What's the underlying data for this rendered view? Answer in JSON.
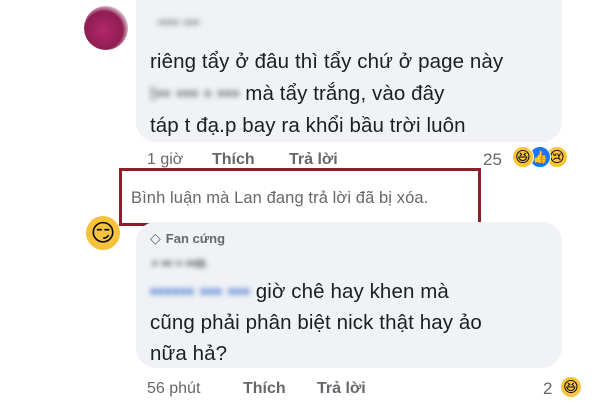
{
  "comment1": {
    "author": "▪▪▪▪ ▪▪▪",
    "line1": "riêng tẩy ở đâu thì tẩy chứ ở page này",
    "line2_blurred": "t▪▪ ▪▪▪ ▪ ▪▪▪",
    "line2": "mà tẩy trắng, vào đây",
    "line3": "táp t đạ.p bay ra khổi bầu trời luôn",
    "time": "1 giờ",
    "like": "Thích",
    "reply": "Trả lời",
    "reaction_count": "25"
  },
  "notice": {
    "text": "Bình luận mà Lan đang trả lời đã bị xóa."
  },
  "comment2": {
    "badge": "Fan cứng",
    "author": "▪ ▪▪ ▪ ▪▪n",
    "line1_blurred": "▪▪▪▪▪▪ ▪▪▪ ▪▪▪",
    "line1": "giờ chê hay khen mà",
    "line2": "cũng phải phân biệt nick thật hay ảo",
    "line3": "nữa hả?",
    "time": "56 phút",
    "like": "Thích",
    "reply": "Trả lời",
    "reaction_count": "2"
  },
  "icons": {
    "haha": "😆",
    "like": "👍",
    "sad": "😢",
    "avatar2": "😏",
    "diamond": "◇"
  },
  "colors": {
    "bubble": "#f0f2f5",
    "meta_text": "#65676b",
    "notice_border": "#8a1f2a",
    "like_blue": "#1877f2"
  }
}
